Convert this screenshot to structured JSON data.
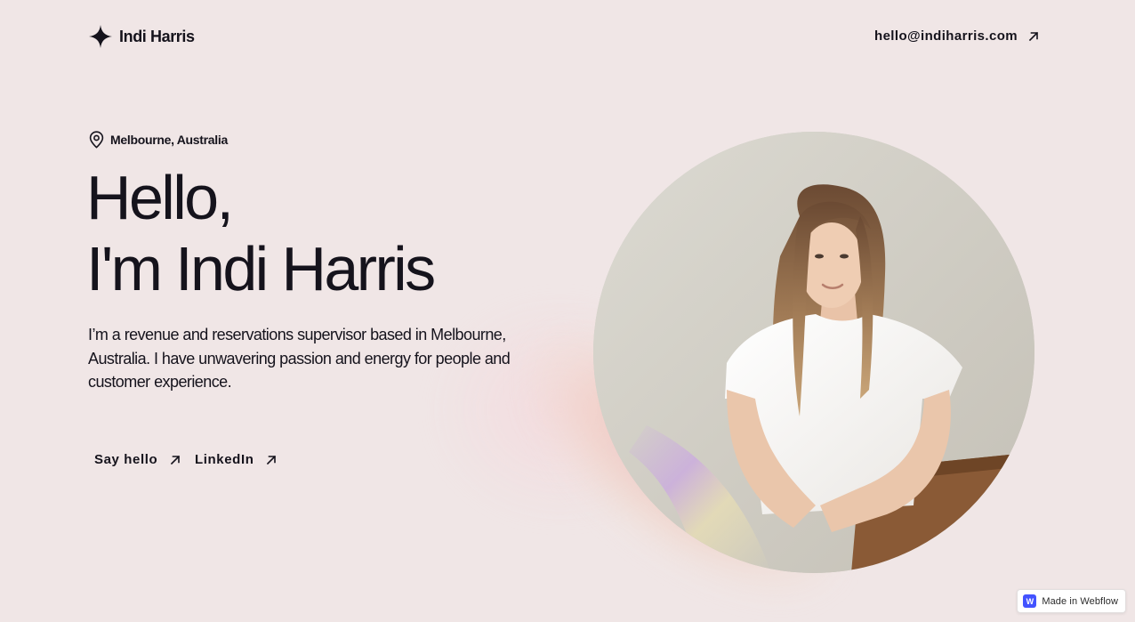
{
  "header": {
    "logo_text": "Indi Harris",
    "email": "hello@indiharris.com"
  },
  "hero": {
    "location": "Melbourne, Australia",
    "title_line1": "Hello,",
    "title_line2": "I'm Indi Harris",
    "bio": "I’m a revenue and reservations supervisor based in Melbourne, Australia. I have unwavering passion and energy for people and customer experience."
  },
  "links": {
    "say_hello": "Say hello",
    "linkedin": "LinkedIn"
  },
  "badge": {
    "text": "Made in Webflow",
    "logo_letter": "W"
  },
  "colors": {
    "background": "#f0e6e6",
    "text": "#15131c",
    "webflow_blue": "#4353ff"
  },
  "icons": {
    "logo": "four-point-star-icon",
    "location": "map-pin-icon",
    "link_arrow": "arrow-up-right-icon"
  }
}
